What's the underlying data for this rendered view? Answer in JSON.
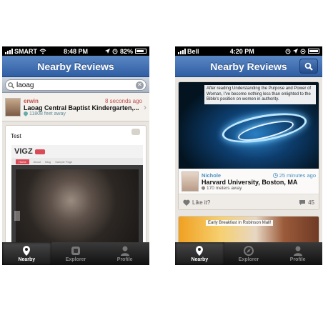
{
  "left": {
    "status": {
      "carrier": "SMART",
      "time": "8:48 PM",
      "battery": "82%"
    },
    "nav": {
      "title": "Nearby Reviews"
    },
    "search": {
      "value": "laoag",
      "clear": "✕"
    },
    "result": {
      "user": "erwin",
      "time": "8 seconds ago",
      "title": "Laoag Central Baptist Kindergarten,...",
      "distance": "11808 feet away"
    },
    "post": {
      "text": "Test",
      "screenshot_logo": "VIGZ",
      "screenshot_nav": [
        "Home",
        "About",
        "Blog",
        "Sample Page"
      ]
    },
    "tabs": [
      {
        "label": "Nearby"
      },
      {
        "label": "Explorer"
      },
      {
        "label": "Profile"
      }
    ]
  },
  "right": {
    "status": {
      "carrier": "Bell",
      "time": "4:20 PM"
    },
    "nav": {
      "title": "Nearby Reviews"
    },
    "card": {
      "caption": "After reading Understanding the Purpose and Power of Woman, I've become nothing less than enlighted to the Bible's position on women in authority.",
      "user": "Nichole",
      "time": "25 minutes ago",
      "title": "Harvard University, Boston, MA",
      "distance": "170 meters away",
      "like_label": "Like it?",
      "comments": "45"
    },
    "card2": {
      "caption": "Early Breakfast in Robinson Mall!"
    },
    "tabs": [
      {
        "label": "Nearby"
      },
      {
        "label": "Explorer"
      },
      {
        "label": "Profile"
      }
    ]
  },
  "colors": {
    "nav_blue": "#2f5ea3",
    "accent_red": "#c0504d",
    "accent_blue": "#4a90c2"
  },
  "icons": [
    "signal-icon",
    "wifi-icon",
    "location-arrow-icon",
    "alarm-icon",
    "battery-icon",
    "search-icon",
    "clear-icon",
    "pin-icon",
    "clock-icon",
    "chevron-right-icon",
    "comment-icon",
    "heart-icon",
    "explorer-icon",
    "profile-icon"
  ]
}
